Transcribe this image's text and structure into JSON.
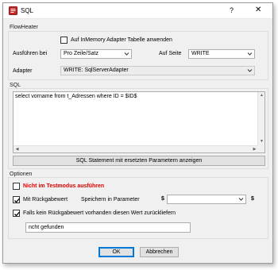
{
  "window": {
    "title": "SQL",
    "help_label": "?",
    "close_label": "✕"
  },
  "flowheater": {
    "group_label": "FlowHeater",
    "inmemory_checkbox_label": "Auf InMemory Adapter Tabelle anwenden",
    "inmemory_checked": false,
    "ausfuehren_label": "Ausführen bei",
    "ausfuehren_value": "Pro Zeile/Satz",
    "seite_label": "Auf Seite",
    "seite_value": "WRITE",
    "adapter_label": "Adapter",
    "adapter_value": "WRITE: SqlServerAdapter"
  },
  "sql": {
    "group_label": "SQL",
    "statement": "select vorname from t_Adressen where ID = $ID$",
    "show_button_label": "SQL Statement mit ersetzten Parametern anzeigen"
  },
  "optionen": {
    "group_label": "Optionen",
    "testmodus_label": "Nicht im Testmodus ausführen",
    "testmodus_checked": false,
    "rueckgabe_label": "Mit Rückgabewert",
    "rueckgabe_checked": true,
    "speichern_label": "Speichern in Parameter",
    "dollar_left": "$",
    "dollar_right": "$",
    "param_value": "",
    "fallback_label": "Falls kein Rückgabewert vorhanden diesen Wert zurückliefern",
    "fallback_checked": true,
    "fallback_value": "ncht gefunden"
  },
  "buttons": {
    "ok_label": "OK",
    "cancel_label": "Abbrechen"
  },
  "colors": {
    "accent": "#0078d7",
    "warning_text": "#e00000",
    "dialog_bg": "#f0f0f0"
  }
}
